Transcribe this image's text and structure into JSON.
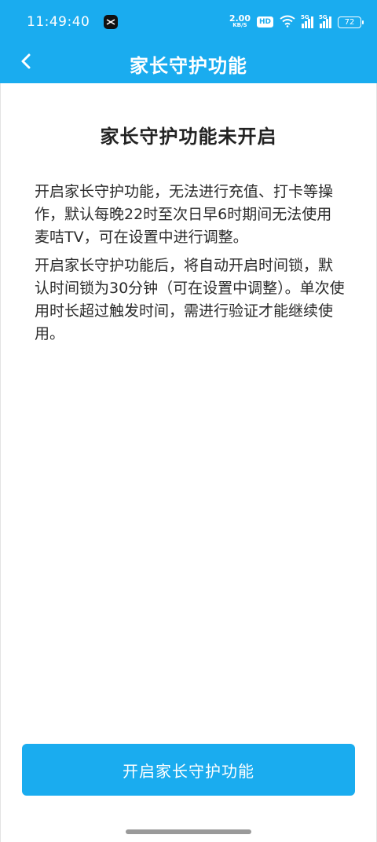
{
  "status_bar": {
    "time": "11:49:40",
    "net_speed_value": "2.00",
    "net_speed_unit": "KB/S",
    "hd_label": "HD",
    "sim1_label": "5G",
    "sim2_label": "5G",
    "battery": "72"
  },
  "nav": {
    "title": "家长守护功能",
    "back_icon": "chevron-left-icon"
  },
  "main": {
    "heading": "家长守护功能未开启",
    "paragraph1": "开启家长守护功能，无法进行充值、打卡等操作，默认每晚22时至次日早6时期间无法使用麦咭TV，可在设置中进行调整。",
    "paragraph2": "开启家长守护功能后，将自动开启时间锁，默认时间锁为30分钟（可在设置中调整）。单次使用时长超过触发时间，需进行验证才能继续使用。"
  },
  "action": {
    "enable_button_label": "开启家长守护功能"
  },
  "colors": {
    "accent": "#1aacef",
    "text": "#2b2b2b",
    "background": "#ffffff"
  }
}
